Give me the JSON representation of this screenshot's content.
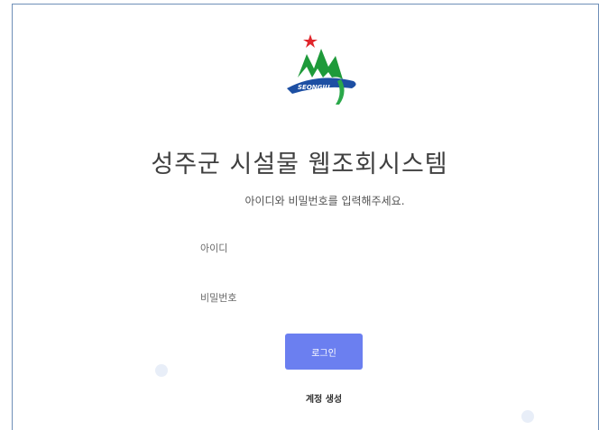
{
  "branding": {
    "logo_text": "SEONGJU"
  },
  "header": {
    "title": "성주군 시설물 웹조회시스템",
    "subtitle": "아이디와 비밀번호를 입력해주세요."
  },
  "form": {
    "username": {
      "placeholder": "아이디",
      "value": ""
    },
    "password": {
      "placeholder": "비밀번호",
      "value": ""
    },
    "login_label": "로그인",
    "signup_label": "계정 생성"
  },
  "colors": {
    "primary_button": "#6b7ff0",
    "frame_border": "#6f8fb8",
    "logo_green": "#1e9a3a",
    "logo_blue": "#1d4fa3",
    "logo_star": "#e0252b"
  }
}
